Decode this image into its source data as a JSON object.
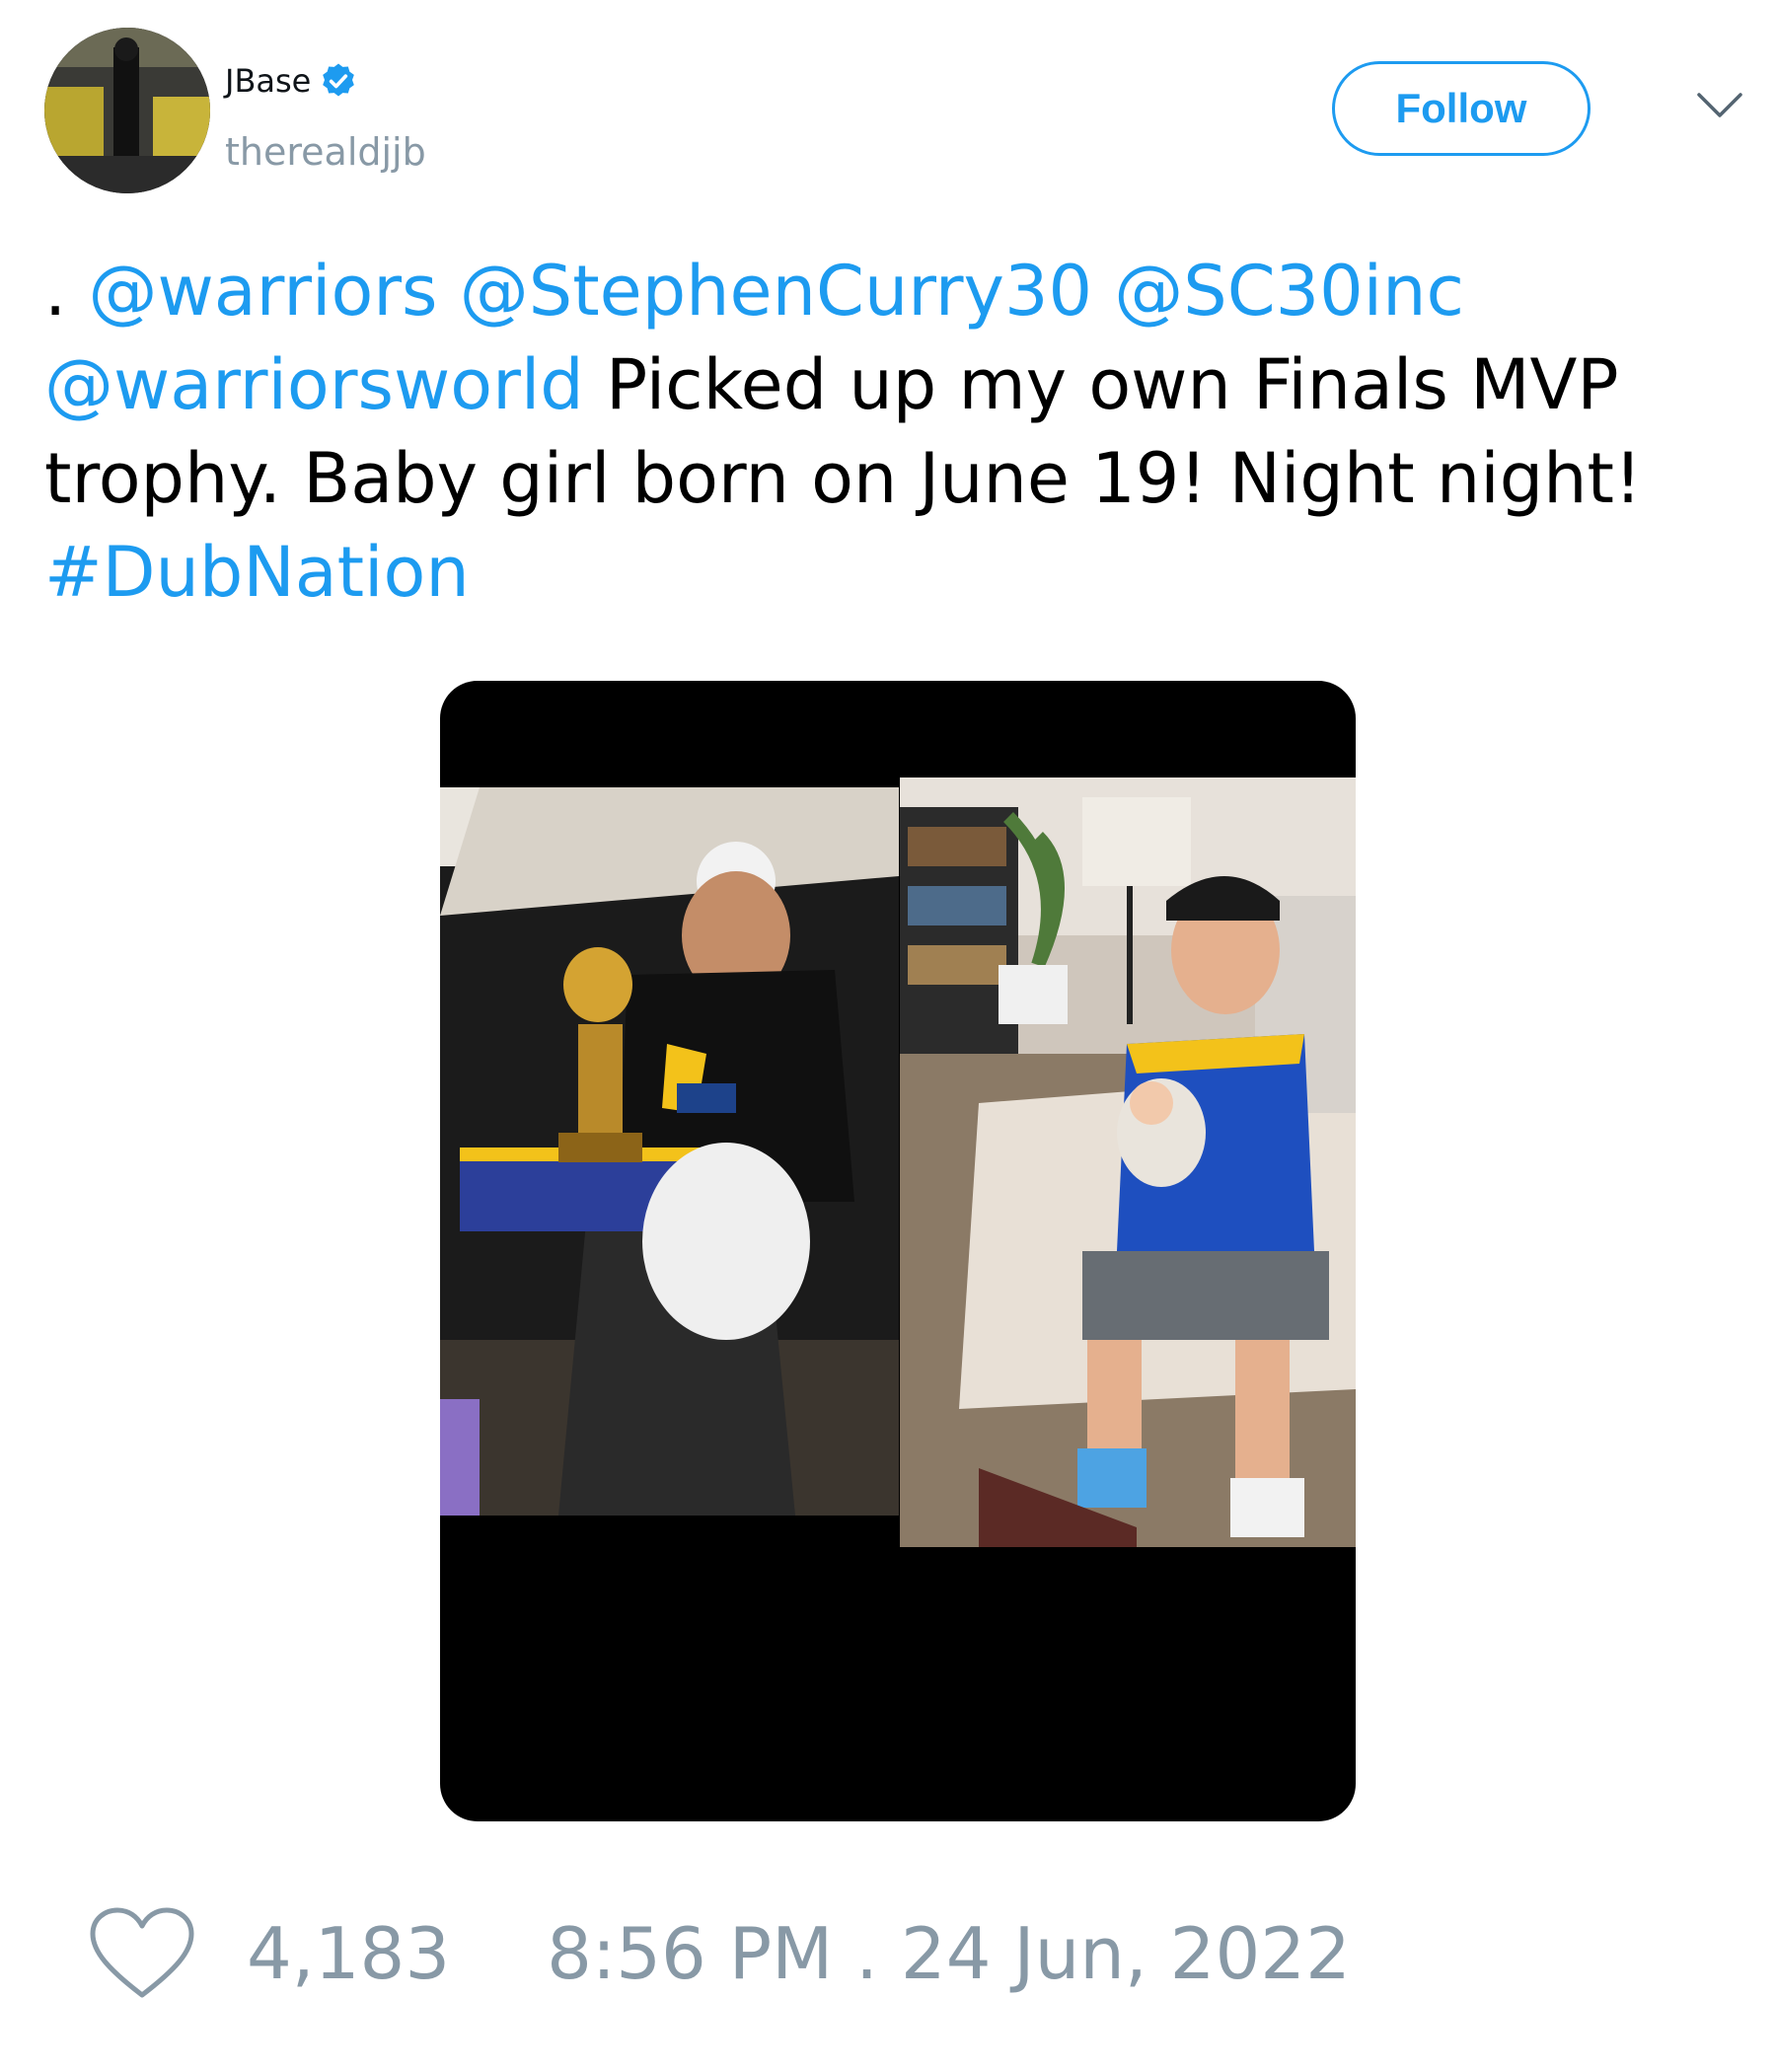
{
  "author": {
    "display_name": "JBase",
    "handle": "therealdjjb",
    "verified": true
  },
  "actions": {
    "follow_label": "Follow"
  },
  "icons": {
    "verified": "verified-badge-icon",
    "menu": "chevron-down-icon",
    "like": "heart-icon"
  },
  "tweet": {
    "prefix": ". ",
    "mention_1": "@warriors",
    "mention_2": "@StephenCurry30",
    "mention_3": "@SC30inc",
    "mention_4": "@warriorsworld",
    "body": "Picked up my own Finals MVP trophy. Baby girl born on June 19! Night night!",
    "hashtag": "#DubNation"
  },
  "footer": {
    "likes": "4,183",
    "timestamp": "8:56 PM . 24 Jun, 2022"
  },
  "colors": {
    "link": "#1d9bf0",
    "muted": "#8899a6",
    "text": "#000000"
  }
}
